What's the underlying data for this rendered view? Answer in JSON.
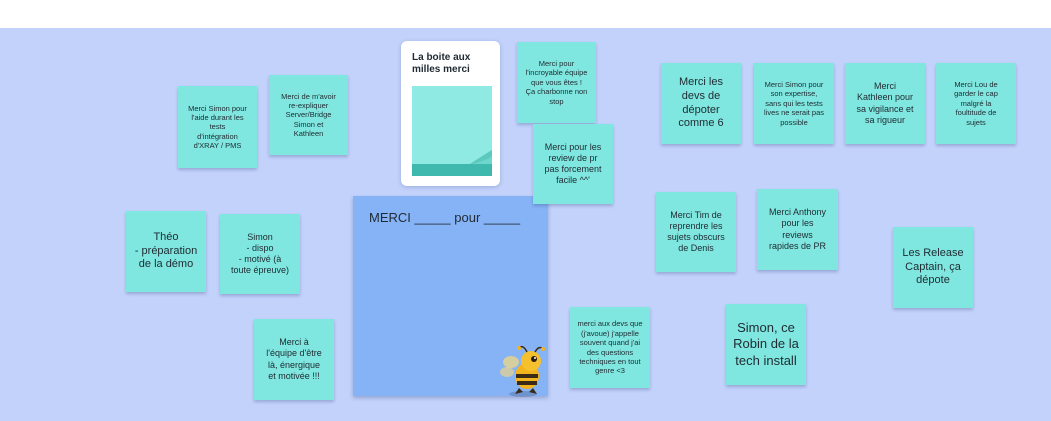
{
  "card": {
    "title": "La boite aux\nmilles merci"
  },
  "blue_sheet": {
    "text": "MERCI _____ pour _____"
  },
  "notes": [
    {
      "id": "n1",
      "text": "Merci Simon pour\nl'aide durant les\ntests\nd'intégration\nd'XRAY / PMS"
    },
    {
      "id": "n2",
      "text": "Merci de m'avoir\nre-expliquer\nServer/Bridge\nSimon et\nKathleen"
    },
    {
      "id": "n3",
      "text": "Merci pour\nl'incroyable équipe\nque vous êtes !\nÇa charbonne non\nstop"
    },
    {
      "id": "n4",
      "text": "Merci pour les\nreview de pr\npas forcement\nfacile ^^'"
    },
    {
      "id": "n5",
      "text": "Merci les\ndevs de\ndépoter\ncomme 6"
    },
    {
      "id": "n6",
      "text": "Merci Simon pour\nson expertise,\nsans qui les tests\nlives ne serait pas\npossible"
    },
    {
      "id": "n7",
      "text": "Merci\nKathleen pour\nsa vigilance et\nsa rigueur"
    },
    {
      "id": "n8",
      "text": "Merci Lou de\ngarder le cap\nmalgré la\nfoultitude de\nsujets"
    },
    {
      "id": "n9",
      "text": "Théo\n- préparation\nde la démo"
    },
    {
      "id": "n10",
      "text": "Simon\n- dispo\n- motivé (à\ntoute épreuve)"
    },
    {
      "id": "n11",
      "text": "Merci Tim de\nreprendre les\nsujets obscurs\nde Denis"
    },
    {
      "id": "n12",
      "text": "Merci Anthony\npour les\nreviews\nrapides de PR"
    },
    {
      "id": "n13",
      "text": "Les Release\nCaptain, ça\ndépote"
    },
    {
      "id": "n14",
      "text": "Merci à\nl'équipe d'être\nlà, énergique\net motivée !!!"
    },
    {
      "id": "n15",
      "text": "merci aux devs que\n(j'avoue) j'appelle\nsouvent quand j'ai\ndes questions\ntechniques  en tout\ngenre <3"
    },
    {
      "id": "n16",
      "text": "Simon, ce\nRobin de la\ntech install"
    }
  ],
  "colors": {
    "board": "#c2d2fb",
    "sticky": "#7fe7df",
    "blue_sheet": "#86b3f6"
  },
  "icons": {
    "card_icon": "sticky-notes-stack-icon",
    "mascot": "bee-mascot-sticker"
  }
}
